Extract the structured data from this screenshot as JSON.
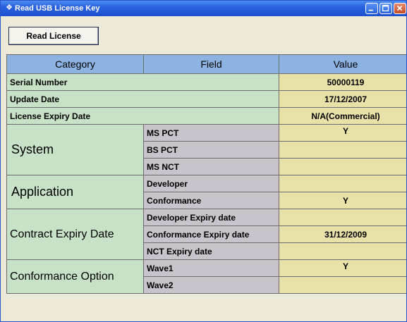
{
  "window": {
    "title": "Read USB License Key",
    "title_icon": "license-icon"
  },
  "toolbar": {
    "read_license_label": "Read License"
  },
  "table": {
    "headers": {
      "category": "Category",
      "field": "Field",
      "value": "Value"
    },
    "serial_number": {
      "label": "Serial Number",
      "value": "50000119"
    },
    "update_date": {
      "label": "Update Date",
      "value": "17/12/2007"
    },
    "license_expiry": {
      "label": "License Expiry Date",
      "value": "N/A(Commercial)"
    },
    "system": {
      "label": "System",
      "fields": [
        {
          "name": "MS PCT",
          "value": "Y"
        },
        {
          "name": "BS PCT",
          "value": ""
        },
        {
          "name": "MS NCT",
          "value": ""
        }
      ]
    },
    "application": {
      "label": "Application",
      "fields": [
        {
          "name": "Developer",
          "value": ""
        },
        {
          "name": "Conformance",
          "value": "Y"
        }
      ]
    },
    "contract_expiry": {
      "label": "Contract Expiry Date",
      "fields": [
        {
          "name": "Developer Expiry date",
          "value": ""
        },
        {
          "name": "Conformance Expiry date",
          "value": "31/12/2009"
        },
        {
          "name": "NCT Expiry date",
          "value": ""
        }
      ]
    },
    "conformance_option": {
      "label": "Conformance Option",
      "fields": [
        {
          "name": "Wave1",
          "value": "Y"
        },
        {
          "name": "Wave2",
          "value": ""
        }
      ]
    }
  },
  "colors": {
    "header": "#8db3e2",
    "category": "#c8e2c8",
    "field": "#c9c3cc",
    "value": "#e8e2a8",
    "titlebar": "#2a62de"
  }
}
